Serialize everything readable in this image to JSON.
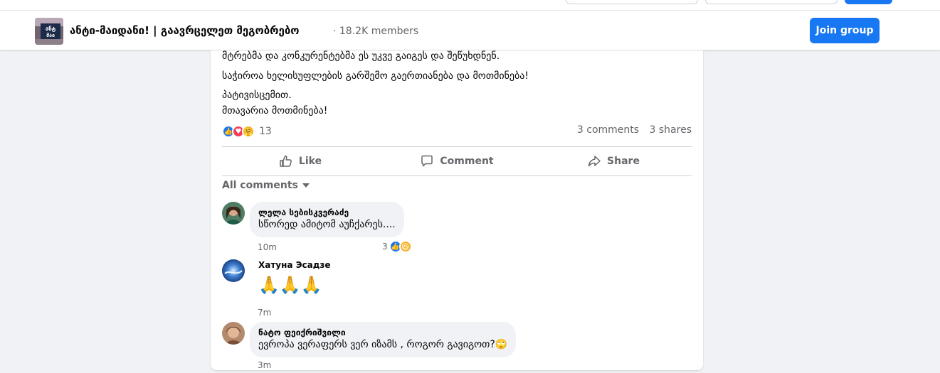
{
  "group": {
    "title": "ანტი-მაიდანი! | გაავრცელეთ მეგობრებო",
    "members": "· 18.2K members",
    "join_label": "Join group",
    "avatar_text": "ანტი მაიდ"
  },
  "post": {
    "lines": [
      "მტრებმა და კონკურენტებმა ეს უკვე გაიგეს და შეწუხდნენ.",
      "საჭიროა ხელისუფლების გარშემო გაერთიანება და მოთმინება!",
      "პატივისცემით.",
      "მთავარია მოთმინება!"
    ],
    "reaction_count": "13",
    "comments_count": "3 comments",
    "shares_count": "3 shares",
    "actions": {
      "like": "Like",
      "comment": "Comment",
      "share": "Share"
    }
  },
  "comments_header": "All comments",
  "comments": [
    {
      "author": "ლელა სებისკვერაძე",
      "text": "სწორედ ამიტომ აუჩქარეს....",
      "time": "10m",
      "reaction_count": "3"
    },
    {
      "author": "Хатуна Эсадзе",
      "text": "🙏🙏🙏",
      "time": "7m"
    },
    {
      "author": "ნატო ფეიქრიშვილი",
      "text": "ევროპა ვერაფერს ვერ იზამს , როგორ გავიგოთ?🙄",
      "time": "3m"
    }
  ],
  "colors": {
    "accent": "#1877f2",
    "like": "#1877f2",
    "love": "#f33e58",
    "care": "#f7b125"
  }
}
